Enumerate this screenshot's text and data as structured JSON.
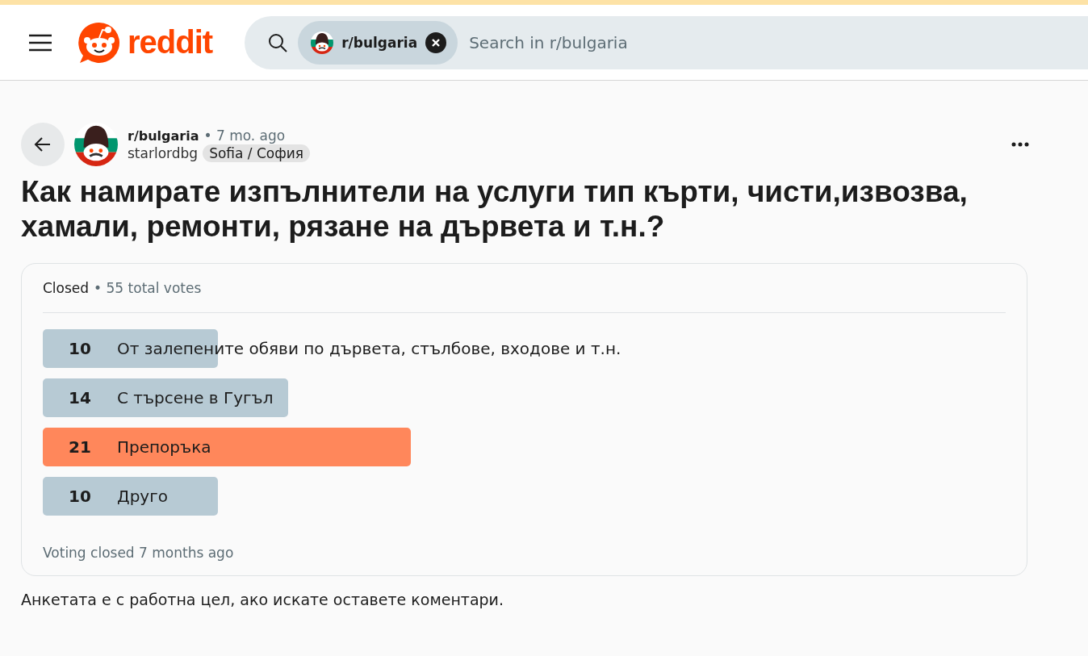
{
  "header": {
    "logo_text": "reddit",
    "search": {
      "community_chip": "r/bulgaria",
      "placeholder": "Search in r/bulgaria"
    }
  },
  "post": {
    "community": "r/bulgaria",
    "time": "• 7 mo. ago",
    "author": "starlordbg",
    "flair": "Sofia / София",
    "title": "Как намирате изпълнители на услуги тип кърти, чисти,извозва, хамали, ремонти, рязане на дървета и т.н.?",
    "poll": {
      "status": "Closed",
      "total": "• 55 total votes",
      "options": [
        {
          "votes": "10",
          "label": "От залепените обяви по дървета, стълбове, входове и т.н.",
          "winner": false
        },
        {
          "votes": "14",
          "label": "С търсене в Гугъл",
          "winner": false
        },
        {
          "votes": "21",
          "label": "Препоръка",
          "winner": true
        },
        {
          "votes": "10",
          "label": "Друго",
          "winner": false
        }
      ],
      "footer": "Voting closed 7 months ago"
    },
    "body": "Анкетата е с работна цел, ако искате оставете коментари."
  }
}
